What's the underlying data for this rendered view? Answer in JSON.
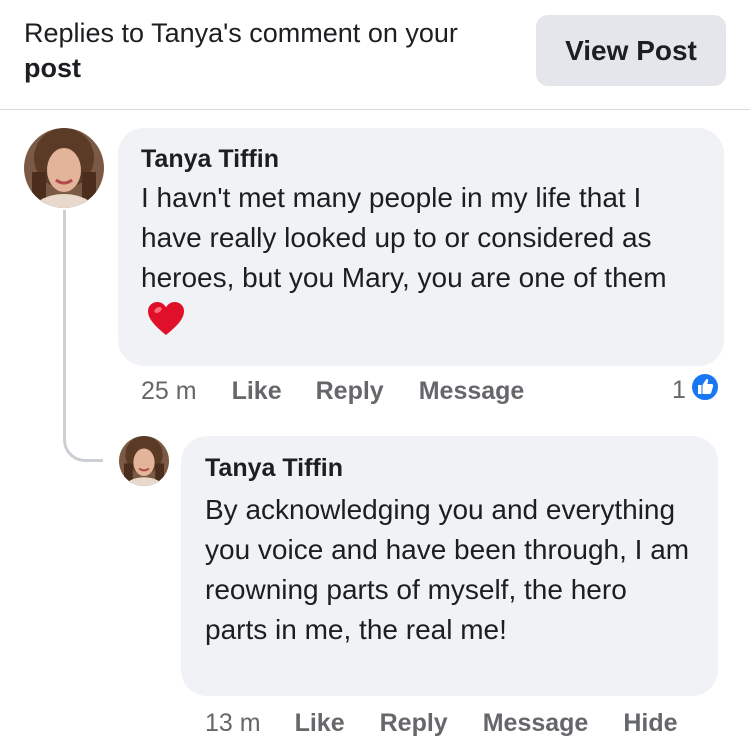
{
  "header": {
    "title_plain": "Replies to Tanya's comment on your",
    "title_bold": "post",
    "view_post_label": "View Post"
  },
  "comments": [
    {
      "author": "Tanya Tiffin",
      "text": "I havn't met many people in my life that I have really looked up to or considered as heroes, but you Mary, you are one of them",
      "emoji": "heart",
      "time": "25 m",
      "actions": [
        "Like",
        "Reply",
        "Message"
      ],
      "reaction_count": "1",
      "reaction_icon": "like-icon"
    },
    {
      "author": "Tanya Tiffin",
      "text": "By acknowledging you and everything you voice and have been through, I am reowning parts of myself, the hero parts in me, the real me!",
      "time": "13 m",
      "actions": [
        "Like",
        "Reply",
        "Message",
        "Hide"
      ]
    }
  ],
  "colors": {
    "bubble": "#f0f2f5",
    "muted_text": "#65676b",
    "like_blue": "#1877f2",
    "heart_red": "#e0102a"
  }
}
